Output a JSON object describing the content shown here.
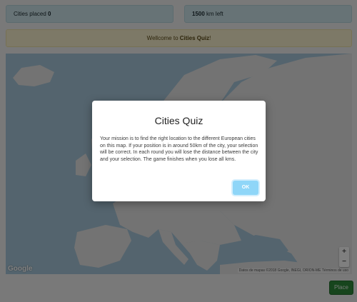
{
  "status": {
    "cities_placed_label": "Cities placed",
    "cities_placed_value": "0",
    "km_value": "1500",
    "km_label": "km left"
  },
  "welcome": {
    "prefix": "Wellcome to",
    "game_name": "Cities Quiz",
    "suffix": "!"
  },
  "map": {
    "logo_text": "Google",
    "attribution": "Datos de mapas ©2018 Google, INEGI, ORION-ME",
    "terms": "Términos de uso",
    "zoom_in": "+",
    "zoom_out": "−",
    "colors": {
      "water": "#a9c9dc",
      "land": "#e6e6e6"
    }
  },
  "modal": {
    "title": "Cities Quiz",
    "body": "Your mission is to find the right location to the different European cities on this map. If your position is in around 50km of the city, your selection will be correct. In each round you will lose the distance between the city and your selection. The game finishes when you lose all kms.",
    "ok_label": "OK"
  },
  "actions": {
    "place_label": "Place"
  }
}
